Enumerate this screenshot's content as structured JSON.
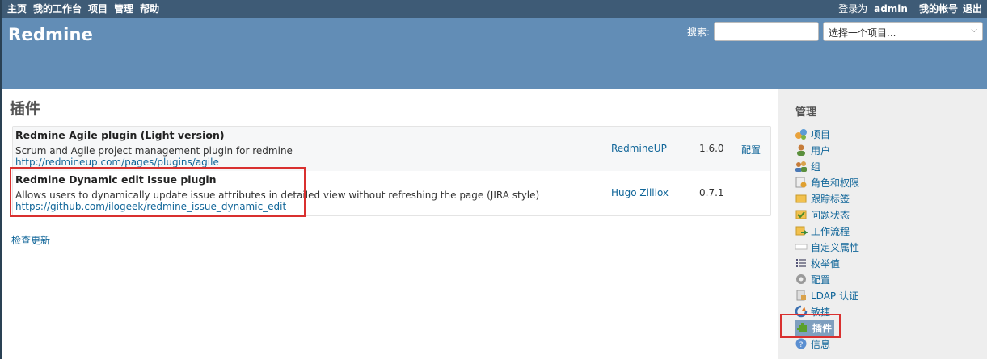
{
  "top_menu": {
    "left": [
      "主页",
      "我的工作台",
      "项目",
      "管理",
      "帮助"
    ],
    "logged_in_prefix": "登录为",
    "user": "admin",
    "my_account": "我的帐号",
    "logout": "退出"
  },
  "header": {
    "title": "Redmine",
    "search_label": "搜索:",
    "search_value": "",
    "project_jump_placeholder": "选择一个项目..."
  },
  "main": {
    "title": "插件",
    "plugins": [
      {
        "name": "Redmine Agile plugin (Light version)",
        "description": "Scrum and Agile project management plugin for redmine",
        "url": "http://redmineup.com/pages/plugins/agile",
        "author": "RedmineUP",
        "version": "1.6.0",
        "configure": "配置"
      },
      {
        "name": "Redmine Dynamic edit Issue plugin",
        "description": "Allows users to dynamically update issue attributes in detailed view without refreshing the page (JIRA style)",
        "url": "https://github.com/ilogeek/redmine_issue_dynamic_edit",
        "author": "Hugo Zilliox",
        "version": "0.7.1",
        "configure": ""
      }
    ],
    "check_updates": "检查更新"
  },
  "sidebar": {
    "title": "管理",
    "items": [
      {
        "label": "项目",
        "icon": "projects-icon"
      },
      {
        "label": "用户",
        "icon": "user-icon"
      },
      {
        "label": "组",
        "icon": "group-icon"
      },
      {
        "label": "角色和权限",
        "icon": "roles-icon"
      },
      {
        "label": "跟踪标签",
        "icon": "tracker-icon"
      },
      {
        "label": "问题状态",
        "icon": "issue-status-icon"
      },
      {
        "label": "工作流程",
        "icon": "workflow-icon"
      },
      {
        "label": "自定义属性",
        "icon": "custom-fields-icon"
      },
      {
        "label": "枚举值",
        "icon": "enumerations-icon"
      },
      {
        "label": "配置",
        "icon": "settings-icon"
      },
      {
        "label": "LDAP 认证",
        "icon": "ldap-icon"
      },
      {
        "label": "敏捷",
        "icon": "agile-icon"
      },
      {
        "label": "插件",
        "icon": "plugin-icon",
        "selected": true
      },
      {
        "label": "信息",
        "icon": "info-icon"
      }
    ]
  },
  "colors": {
    "top_menu_bg": "#3e5b76",
    "header_bg": "#628db6",
    "link": "#169",
    "highlight": "#d9302f",
    "selected_bg": "#7e9fbf"
  }
}
